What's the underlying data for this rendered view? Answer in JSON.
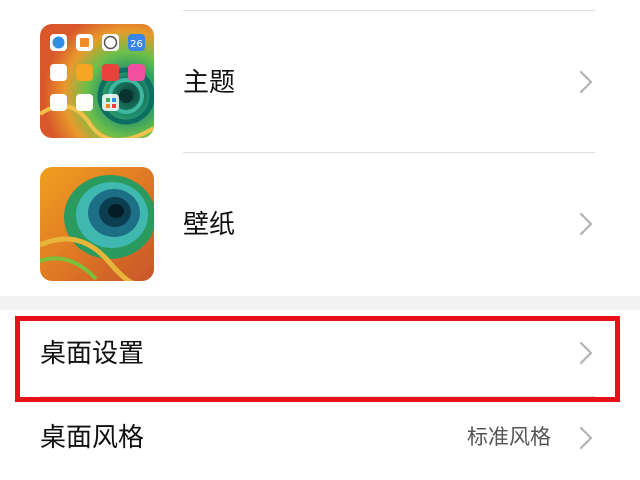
{
  "settings": {
    "theme": {
      "label": "主题",
      "icon": "theme-preview-thumbnail",
      "preview_icon_text": "26"
    },
    "wallpaper": {
      "label": "壁纸",
      "icon": "wallpaper-preview-thumbnail"
    },
    "desktop_settings": {
      "label": "桌面设置",
      "highlighted": true,
      "highlight_color": "#e8111a"
    },
    "desktop_style": {
      "label": "桌面风格",
      "value": "标准风格"
    }
  },
  "colors": {
    "chevron": "#b3b3b3",
    "divider": "#dedede",
    "section_gap": "#f2f2f2"
  }
}
